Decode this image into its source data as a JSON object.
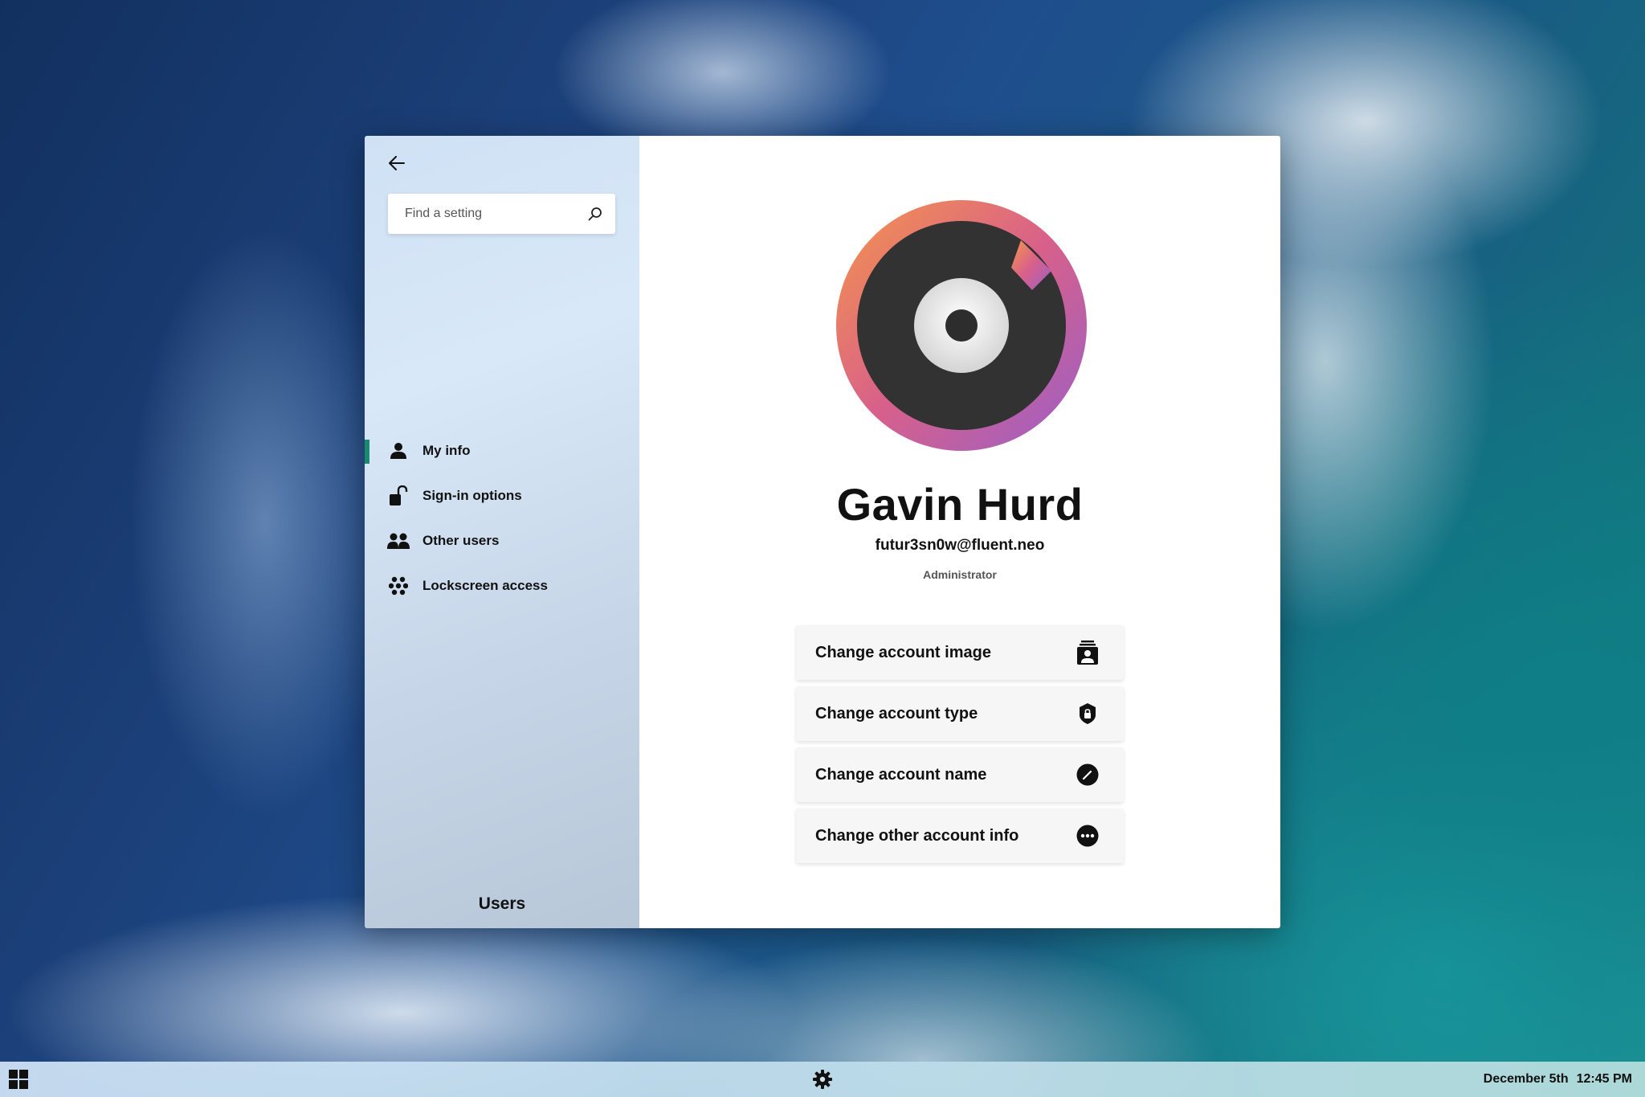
{
  "sidebar": {
    "search_placeholder": "Find a setting",
    "items": [
      {
        "label": "My info",
        "icon": "person-icon",
        "active": true
      },
      {
        "label": "Sign-in options",
        "icon": "unlock-icon",
        "active": false
      },
      {
        "label": "Other users",
        "icon": "people-icon",
        "active": false
      },
      {
        "label": "Lockscreen access",
        "icon": "dots-cluster-icon",
        "active": false
      }
    ],
    "footer_title": "Users"
  },
  "profile": {
    "name": "Gavin Hurd",
    "email": "futur3sn0w@fluent.neo",
    "role": "Administrator",
    "avatar_colors": [
      "#f5964a",
      "#d8608a",
      "#9a5fc8"
    ]
  },
  "actions": [
    {
      "label": "Change account image",
      "icon": "contact-card-icon"
    },
    {
      "label": "Change account type",
      "icon": "shield-lock-icon"
    },
    {
      "label": "Change account name",
      "icon": "edit-circle-icon"
    },
    {
      "label": "Change other account info",
      "icon": "more-circle-icon"
    }
  ],
  "taskbar": {
    "date": "December 5th",
    "time": "12:45 PM"
  },
  "colors": {
    "accent": "#1a8a6e"
  }
}
